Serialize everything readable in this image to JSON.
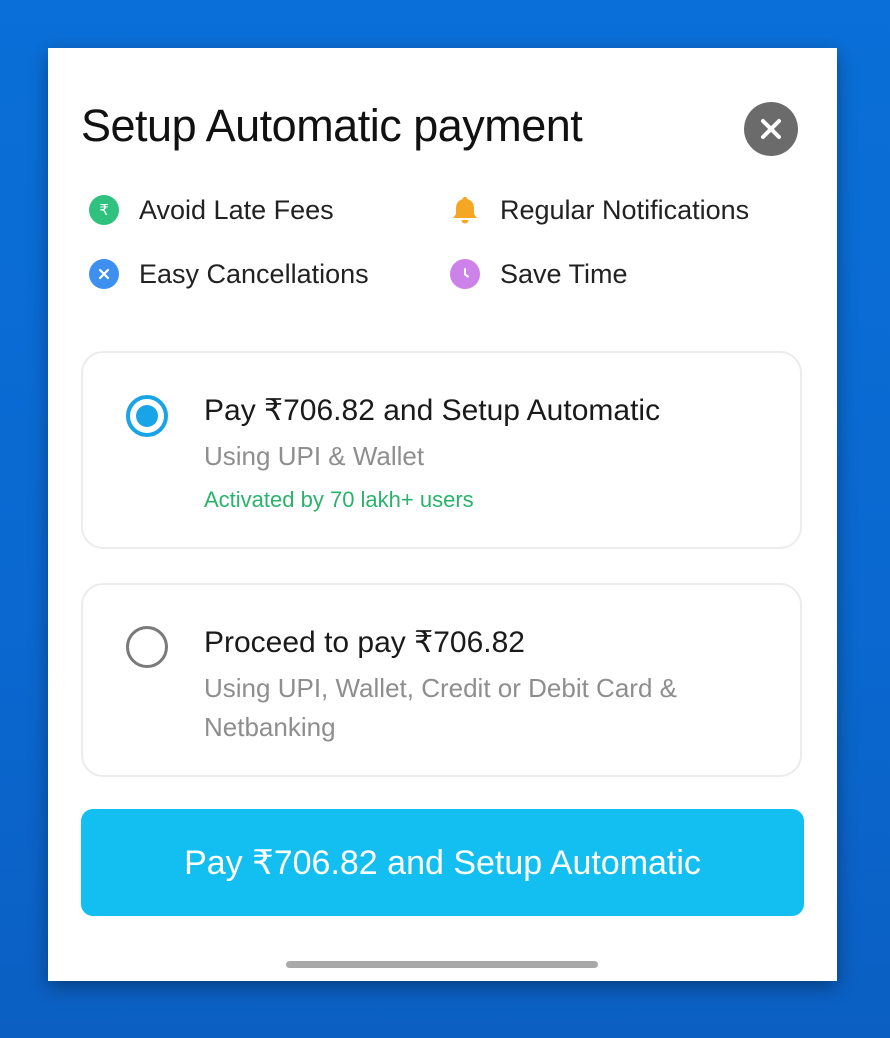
{
  "dialog": {
    "title": "Setup Automatic payment",
    "close_icon": "close-icon"
  },
  "benefits": [
    {
      "label": "Avoid Late Fees",
      "icon": "rupee-icon",
      "color": "#2ec27e"
    },
    {
      "label": "Regular Notifications",
      "icon": "bell-icon",
      "color": "#f5a623"
    },
    {
      "label": "Easy Cancellations",
      "icon": "cross-icon",
      "color": "#3d8ff0"
    },
    {
      "label": "Save Time",
      "icon": "clock-icon",
      "color": "#cc82e8"
    }
  ],
  "options": [
    {
      "title": "Pay ₹706.82 and Setup Automatic",
      "subtitle": "Using UPI & Wallet",
      "note": "Activated by 70 lakh+ users",
      "selected": true
    },
    {
      "title": "Proceed to pay ₹706.82",
      "subtitle": "Using UPI, Wallet, Credit or Debit Card & Netbanking",
      "selected": false
    }
  ],
  "primary_button": {
    "label": "Pay ₹706.82 and Setup Automatic"
  },
  "colors": {
    "accent": "#12bff0",
    "radio_selected": "#1aa4e8",
    "note_green": "#2ab36b",
    "background": "#0a6fd8"
  }
}
